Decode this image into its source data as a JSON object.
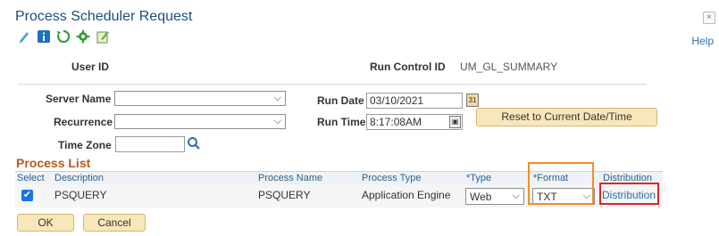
{
  "window": {
    "title": "Process Scheduler Request",
    "close_label": "×",
    "help_label": "Help"
  },
  "toolbar": {
    "icons": [
      "spellcheck-icon",
      "info-icon",
      "refresh-icon",
      "settings-icon",
      "notepad-icon"
    ]
  },
  "header": {
    "user_id_label": "User ID",
    "user_id_value": "",
    "run_control_label": "Run Control ID",
    "run_control_value": "UM_GL_SUMMARY"
  },
  "form": {
    "server_name_label": "Server Name",
    "server_name_value": "",
    "recurrence_label": "Recurrence",
    "recurrence_value": "",
    "time_zone_label": "Time Zone",
    "time_zone_value": "",
    "run_date_label": "Run Date",
    "run_date_value": "03/10/2021",
    "run_time_label": "Run Time",
    "run_time_value": "8:17:08AM",
    "reset_button_label": "Reset to Current Date/Time"
  },
  "process_list": {
    "title": "Process List",
    "columns": [
      "Select",
      "Description",
      "Process Name",
      "Process Type",
      "*Type",
      "*Format",
      "Distribution"
    ],
    "rows": [
      {
        "selected": true,
        "description": "PSQUERY",
        "process_name": "PSQUERY",
        "process_type": "Application Engine",
        "type": "Web",
        "format": "TXT",
        "distribution": "Distribution"
      }
    ]
  },
  "actions": {
    "ok_label": "OK",
    "cancel_label": "Cancel"
  },
  "colors": {
    "title": "#1f4d7a",
    "section": "#b8581b",
    "link": "#2c6fb0",
    "button_bg": "#f8e7ba",
    "highlight_orange": "#f28c28",
    "highlight_red": "#d9262c"
  }
}
